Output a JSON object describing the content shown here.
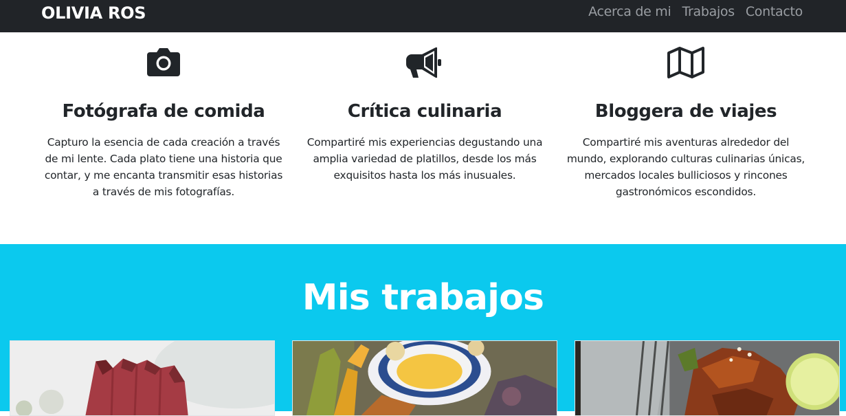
{
  "navbar": {
    "brand": "OLIVIA ROS",
    "links": [
      "Acerca de mi",
      "Trabajos",
      "Contacto"
    ]
  },
  "services": [
    {
      "icon": "camera-icon",
      "title": "Fotógrafa de comida",
      "text": "Capturo la esencia de cada creación a través de mi lente. Cada plato tiene una historia que contar, y me encanta transmitir esas historias a través de mis fotografías."
    },
    {
      "icon": "megaphone-icon",
      "title": "Crítica culinaria",
      "text": "Compartiré mis experiencias degustando una amplia variedad de platillos, desde los más exquisitos hasta los más inusuales."
    },
    {
      "icon": "map-icon",
      "title": "Bloggera de viajes",
      "text": "Compartiré mis aventuras alrededor del mundo, explorando culturas culinarias únicas, mercados locales bulliciosos y rincones gastronómicos escondidos."
    }
  ],
  "works": {
    "title": "Mis trabajos"
  },
  "colors": {
    "navbar_bg": "#212428",
    "accent_cyan": "#0bc9ee",
    "nav_link": "#9a9ea3"
  }
}
